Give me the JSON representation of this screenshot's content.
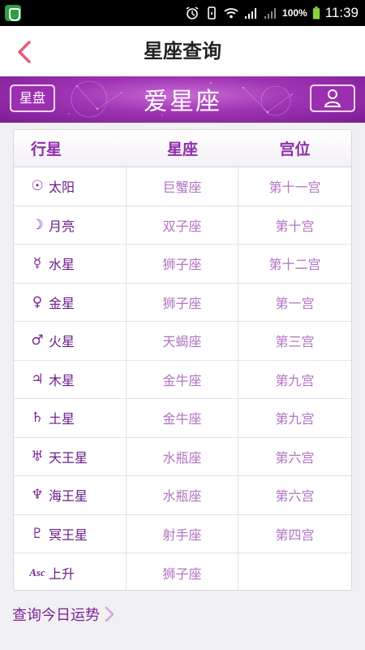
{
  "status_bar": {
    "battery_percent": "100%",
    "time": "11:39"
  },
  "header": {
    "title": "星座查询"
  },
  "banner": {
    "chart_button_label": "星盘",
    "brand_text": "爱星座"
  },
  "table": {
    "headers": [
      "行星",
      "星座",
      "宫位"
    ],
    "rows": [
      {
        "glyph": "☉",
        "planet": "太阳",
        "sign": "巨蟹座",
        "house": "第十一宫"
      },
      {
        "glyph": "☽",
        "planet": "月亮",
        "sign": "双子座",
        "house": "第十宫"
      },
      {
        "glyph": "☿",
        "planet": "水星",
        "sign": "狮子座",
        "house": "第十二宫"
      },
      {
        "glyph": "♀",
        "planet": "金星",
        "sign": "狮子座",
        "house": "第一宫"
      },
      {
        "glyph": "♂",
        "planet": "火星",
        "sign": "天蝎座",
        "house": "第三宫"
      },
      {
        "glyph": "♃",
        "planet": "木星",
        "sign": "金牛座",
        "house": "第九宫"
      },
      {
        "glyph": "♄",
        "planet": "土星",
        "sign": "金牛座",
        "house": "第九宫"
      },
      {
        "glyph": "♅",
        "planet": "天王星",
        "sign": "水瓶座",
        "house": "第六宫"
      },
      {
        "glyph": "♆",
        "planet": "海王星",
        "sign": "水瓶座",
        "house": "第六宫"
      },
      {
        "glyph": "♇",
        "planet": "冥王星",
        "sign": "射手座",
        "house": "第四宫"
      },
      {
        "glyph": "Asc",
        "planet": "上升",
        "sign": "狮子座",
        "house": ""
      }
    ]
  },
  "footer": {
    "link_label": "查询今日运势"
  },
  "colors": {
    "accent": "#8e2ea8",
    "back_arrow": "#e85a78",
    "banner": "#9e34b3"
  }
}
